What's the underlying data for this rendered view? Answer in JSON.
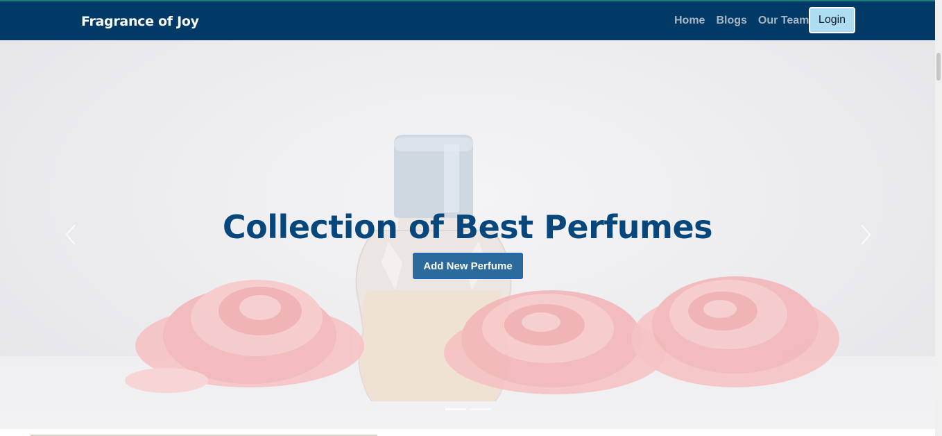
{
  "navbar": {
    "brand": "Fragrance of Joy",
    "links": [
      {
        "label": "Home"
      },
      {
        "label": "Blogs"
      },
      {
        "label": "Our Team"
      }
    ],
    "login_label": "Login"
  },
  "hero": {
    "title": "Collection of Best Perfumes",
    "add_button_label": "Add New Perfume",
    "prev_icon": "chevron-left-icon",
    "next_icon": "chevron-right-icon",
    "slides_count": 2,
    "active_slide": 1
  },
  "colors": {
    "navbar_bg": "#013a66",
    "title": "#08477b",
    "add_button_bg": "#2a6a9c",
    "login_bg": "#aedcf0"
  }
}
